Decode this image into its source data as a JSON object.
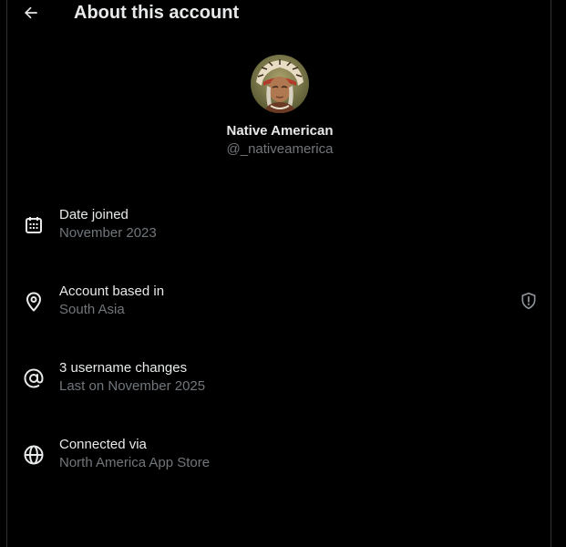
{
  "header": {
    "title": "About this account",
    "back_icon": "arrow-left-icon"
  },
  "profile": {
    "display_name": "Native American",
    "handle": "@_nativeamerica"
  },
  "details": [
    {
      "icon": "calendar-icon",
      "label": "Date joined",
      "value": "November 2023"
    },
    {
      "icon": "location-pin-icon",
      "label": "Account based in",
      "value": "South Asia",
      "extra_icon": "shield-alert-icon"
    },
    {
      "icon": "at-sign-icon",
      "label": "3 username changes",
      "value": "Last on November 2025"
    },
    {
      "icon": "globe-icon",
      "label": "Connected via",
      "value": "North America App Store"
    }
  ],
  "colors": {
    "background": "#000000",
    "primary_text": "#e7e9ea",
    "secondary_text": "#71767b",
    "border": "#2f3336"
  }
}
